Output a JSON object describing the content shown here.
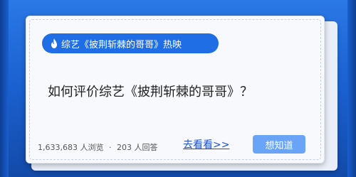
{
  "tag": {
    "text": "综艺《披荆斩棘的哥哥》热映",
    "icon": "flame-icon"
  },
  "question": "如何评价综艺《披荆斩棘的哥哥》？",
  "stats": {
    "views": "1,633,683",
    "views_label": "人浏览",
    "separator": "·",
    "answers": "203",
    "answers_label": "人回答"
  },
  "link_label": "去看看>>",
  "button_label": "想知道",
  "colors": {
    "background": "#1a5fcf",
    "tag": "#1f6ee6",
    "button": "#6aa4f7",
    "link": "#1f4fc8"
  }
}
